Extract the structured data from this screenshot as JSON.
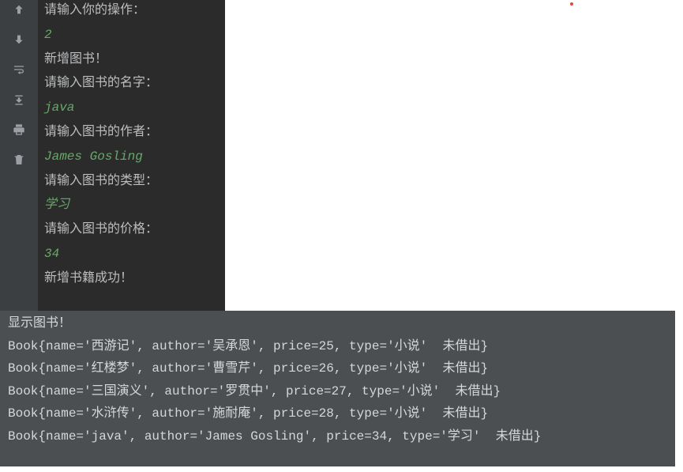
{
  "console": {
    "lines": [
      {
        "text": "请输入你的操作：",
        "style": "prompt"
      },
      {
        "text": "2",
        "style": "input"
      },
      {
        "text": "新增图书！",
        "style": "prompt"
      },
      {
        "text": "请输入图书的名字：",
        "style": "prompt"
      },
      {
        "text": "java",
        "style": "input"
      },
      {
        "text": "请输入图书的作者：",
        "style": "prompt"
      },
      {
        "text": "James Gosling",
        "style": "input"
      },
      {
        "text": "请输入图书的类型：",
        "style": "prompt"
      },
      {
        "text": "学习",
        "style": "input"
      },
      {
        "text": "请输入图书的价格：",
        "style": "prompt"
      },
      {
        "text": "34",
        "style": "input"
      },
      {
        "text": "新增书籍成功！",
        "style": "prompt"
      }
    ]
  },
  "output": {
    "header": "显示图书！",
    "books": [
      {
        "name": "西游记",
        "author": "吴承恩",
        "price": 25,
        "type": "小说",
        "status": "未借出"
      },
      {
        "name": "红楼梦",
        "author": "曹雪芹",
        "price": 26,
        "type": "小说",
        "status": "未借出"
      },
      {
        "name": "三国演义",
        "author": "罗贯中",
        "price": 27,
        "type": "小说",
        "status": "未借出"
      },
      {
        "name": "水浒传",
        "author": "施耐庵",
        "price": 28,
        "type": "小说",
        "status": "未借出"
      },
      {
        "name": "java",
        "author": "James Gosling",
        "price": 34,
        "type": "学习",
        "status": "未借出"
      }
    ]
  },
  "icons": {
    "up": "arrow-up",
    "down": "arrow-down",
    "wrap": "wrap",
    "download": "download",
    "print": "print",
    "clip": "clip"
  }
}
